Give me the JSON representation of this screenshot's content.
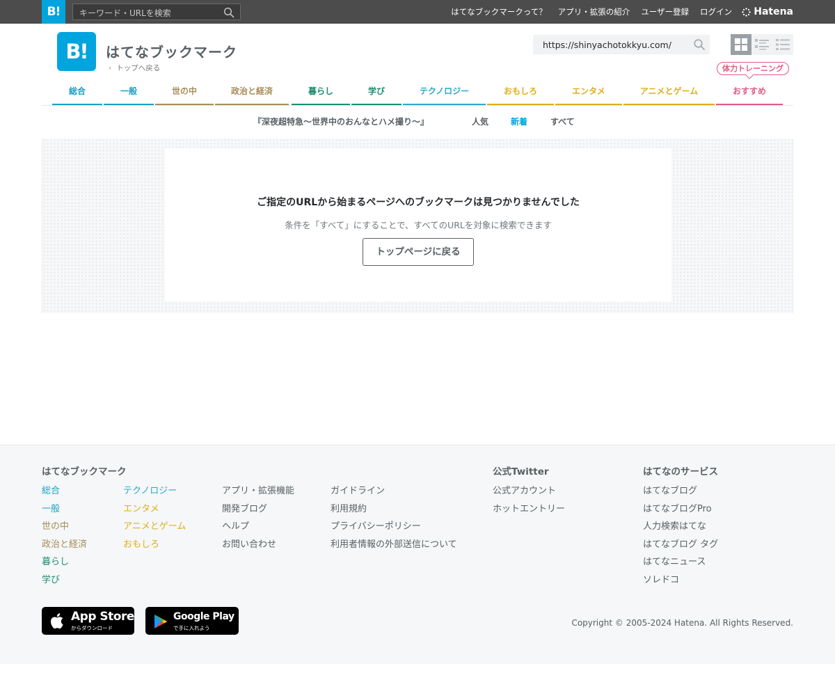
{
  "colors": {
    "brand": "#00a4de",
    "gbar_bg": "#4c4c4c",
    "cat_blue": "#1a9ec4",
    "cat_brown": "#a88c5a",
    "cat_green": "#1e8c72",
    "cat_cyan": "#2ba8c9",
    "cat_yellow": "#e0ad1f",
    "cat_pink": "#e05a84"
  },
  "global_bar": {
    "logo": "B!",
    "search_placeholder": "キーワード・URLを検索",
    "links": [
      "はてなブックマークって？",
      "アプリ・拡張の紹介",
      "ユーザー登録",
      "ログイン"
    ],
    "hatena_label": "Hatena"
  },
  "header": {
    "logo": "B!",
    "title": "はてなブックマーク",
    "back_link": "トップへ戻る",
    "url_value": "https://shinyachotokkyu.com/",
    "badge": "体力トレーニング"
  },
  "categories": [
    {
      "label": "総合",
      "color": "#1a9ec4"
    },
    {
      "label": "一般",
      "color": "#1a9ec4"
    },
    {
      "label": "世の中",
      "color": "#a88c5a"
    },
    {
      "label": "政治と経済",
      "color": "#a88c5a"
    },
    {
      "label": "暮らし",
      "color": "#1e8c72"
    },
    {
      "label": "学び",
      "color": "#1e8c72"
    },
    {
      "label": "テクノロジー",
      "color": "#2ba8c9"
    },
    {
      "label": "おもしろ",
      "color": "#e0ad1f"
    },
    {
      "label": "エンタメ",
      "color": "#e0ad1f"
    },
    {
      "label": "アニメとゲーム",
      "color": "#e0ad1f"
    },
    {
      "label": "おすすめ",
      "color": "#e05a84"
    }
  ],
  "subnav": {
    "title": "『深夜超特急〜世界中のおんなとハメ撮り〜』",
    "tabs": [
      "人気",
      "新着",
      "すべて"
    ],
    "active_tab": "新着"
  },
  "empty_state": {
    "title": "ご指定のURLから始まるページへのブックマークは見つかりませんでした",
    "subtitle": "条件を「すべて」にすることで、すべてのURLを対象に検索できます",
    "button": "トップページに戻る"
  },
  "footer": {
    "bookmark_heading": "はてなブックマーク",
    "cat_col1": [
      "総合",
      "一般",
      "世の中",
      "政治と経済",
      "暮らし",
      "学び"
    ],
    "cat_col2": [
      "テクノロジー",
      "エンタメ",
      "アニメとゲーム",
      "おもしろ"
    ],
    "links_col1": [
      "アプリ・拡張機能",
      "開発ブログ",
      "ヘルプ",
      "お問い合わせ"
    ],
    "links_col2": [
      "ガイドライン",
      "利用規約",
      "プライバシーポリシー",
      "利用者情報の外部送信について"
    ],
    "twitter_heading": "公式Twitter",
    "twitter_links": [
      "公式アカウント",
      "ホットエントリー"
    ],
    "services_heading": "はてなのサービス",
    "services": [
      "はてなブログ",
      "はてなブログPro",
      "人力検索はてな",
      "はてなブログ タグ",
      "はてなニュース",
      "ソレドコ"
    ],
    "app_store": {
      "big": "App Store",
      "small": "からダウンロード"
    },
    "google_play": {
      "big": "Google Play",
      "small": "で手に入れよう"
    },
    "copyright": "Copyright © 2005-2024 Hatena. All Rights Reserved."
  }
}
